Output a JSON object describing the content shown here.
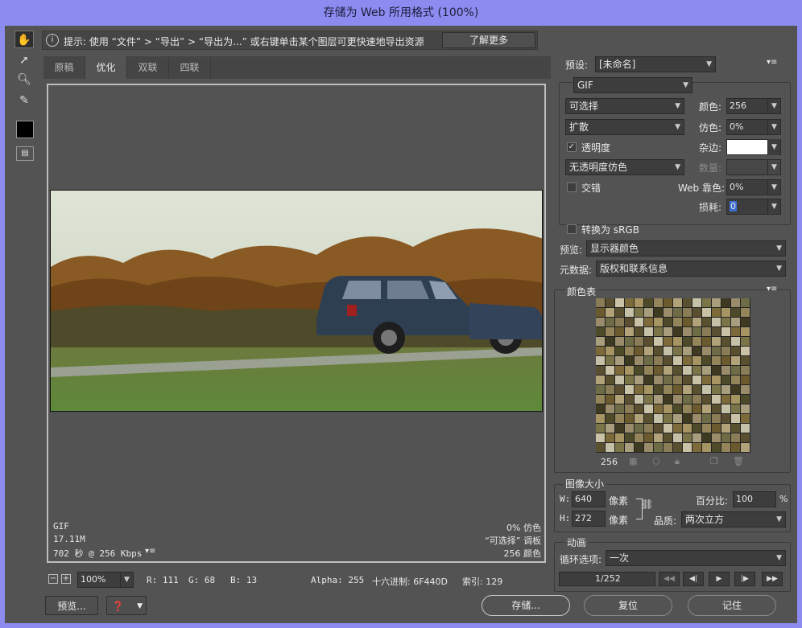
{
  "window": {
    "title": "存储为 Web 所用格式 (100%)"
  },
  "hint": {
    "text": "提示: 使用 “文件” > “导出” > “导出为...” 或右键单击某个图层可更快速地导出资源",
    "button": "了解更多"
  },
  "tabs": [
    "原稿",
    "优化",
    "双联",
    "四联"
  ],
  "active_tab": "优化",
  "preview": {
    "info_left": [
      "GIF",
      "17.11M",
      "702 秒 @ 256 Kbps"
    ],
    "info_right": [
      "0% 仿色",
      "“可选择” 调板",
      "256 颜色"
    ]
  },
  "status": {
    "zoom": "100%",
    "r": "R: 111",
    "g": "G: 68",
    "b": "B: 13",
    "alpha": "Alpha: 255",
    "hex": "十六进制: 6F440D",
    "index": "索引: 129"
  },
  "bottom": {
    "preview": "预览...",
    "save": "存储...",
    "reset": "复位",
    "remember": "记住"
  },
  "settings": {
    "preset_label": "预设:",
    "preset_value": "[未命名]",
    "format": "GIF",
    "reduction": "可选择",
    "colors_label": "颜色:",
    "colors_value": "256",
    "dither_algo": "扩散",
    "dither_label": "仿色:",
    "dither_value": "0%",
    "transparency": "透明度",
    "matte_label": "杂边:",
    "trans_dither": "无透明度仿色",
    "amount_label": "数量:",
    "interlaced": "交错",
    "websnap_label": "Web 靠色:",
    "websnap_value": "0%",
    "lossy_label": "损耗:",
    "lossy_value": "0",
    "srgb": "转换为 sRGB",
    "preview_label": "预览:",
    "preview_value": "显示器颜色",
    "metadata_label": "元数据:",
    "metadata_value": "版权和联系信息"
  },
  "color_table": {
    "title": "颜色表",
    "count": "256",
    "colors": [
      "#8a7c56",
      "#6b5a2e",
      "#9a8b6a",
      "#4d4a2a",
      "#a89e7e",
      "#7c6a3a",
      "#c5c1a8",
      "#5a4e30",
      "#b2a27a",
      "#6e6c46",
      "#93845a",
      "#3e3a22",
      "#a79463",
      "#7a7448",
      "#c9c2a6",
      "#58502e"
    ]
  },
  "image_size": {
    "title": "图像大小",
    "w_label": "W:",
    "w_value": "640",
    "h_label": "H:",
    "h_value": "272",
    "unit": "像素",
    "percent_label": "百分比:",
    "percent_value": "100",
    "percent_unit": "%",
    "quality_label": "品质:",
    "quality_value": "两次立方"
  },
  "animation": {
    "title": "动画",
    "loop_label": "循环选项:",
    "loop_value": "一次",
    "frame": "1/252"
  },
  "colors": {
    "accent": "#8c8cf0",
    "panel": "#535353",
    "field": "#3d3d3d"
  }
}
